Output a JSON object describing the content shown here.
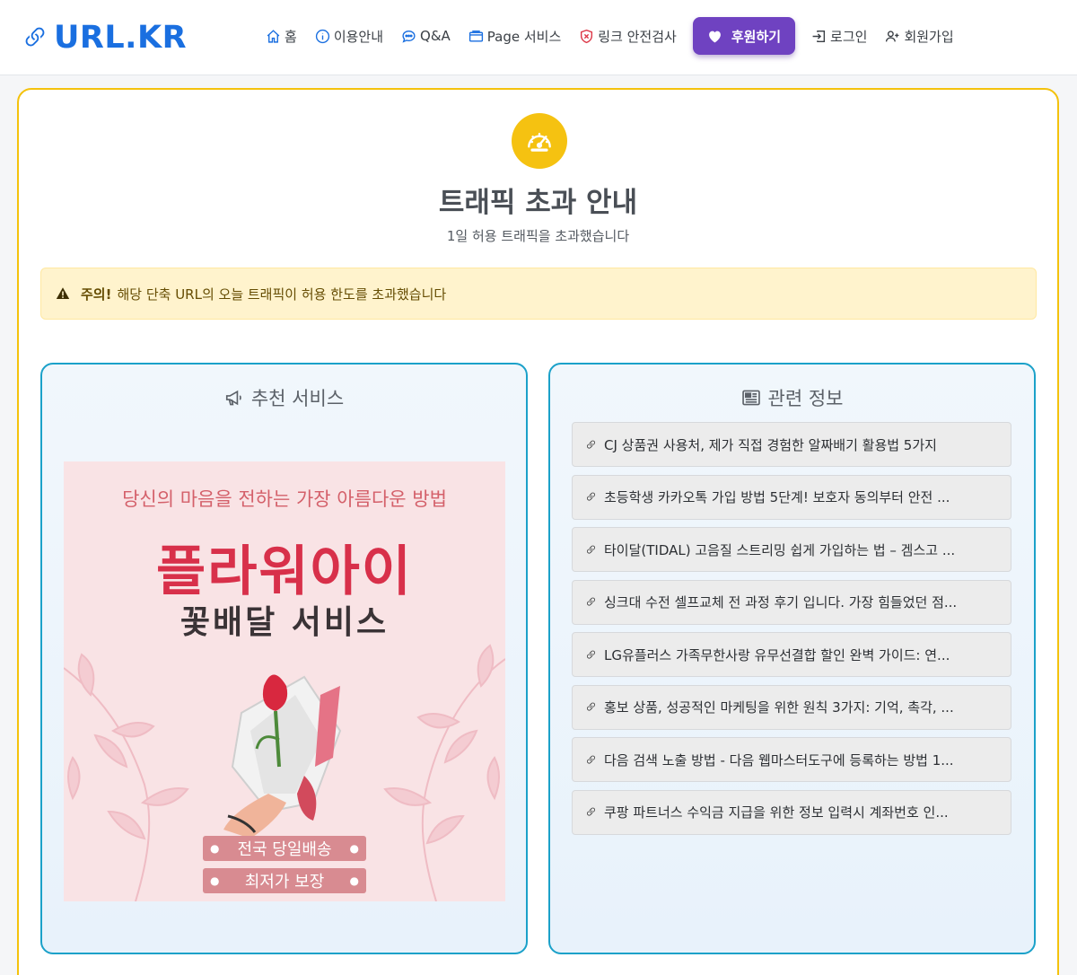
{
  "brand": {
    "name": "URL.KR",
    "icon": "link-icon"
  },
  "nav": {
    "items": [
      {
        "label": "홈",
        "icon": "house-icon"
      },
      {
        "label": "이용안내",
        "icon": "info-circle-icon"
      },
      {
        "label": "Q&A",
        "icon": "chat-dots-icon"
      },
      {
        "label": "Page 서비스",
        "icon": "window-icon"
      },
      {
        "label": "링크 안전검사",
        "icon": "shield-x-icon"
      },
      {
        "label": "후원하기",
        "icon": "heart-icon"
      },
      {
        "label": "로그인",
        "icon": "box-arrow-in-right-icon"
      },
      {
        "label": "회원가입",
        "icon": "person-plus-icon"
      }
    ]
  },
  "main": {
    "icon": "speedometer-icon",
    "title": "트래픽 초과 안내",
    "subtitle": "1일 허용 트래픽을 초과했습니다",
    "alert": {
      "strong": "주의!",
      "text": "해당 단축 URL의 오늘 트래픽이 허용 한도를 초과했습니다"
    }
  },
  "recommend": {
    "title": "추천 서비스",
    "ad": {
      "tagline": "당신의 마음을 전하는 가장 아름다운 방법",
      "brand": "플라워아이",
      "service": "꽃배달 서비스",
      "pill1": "전국 당일배송",
      "pill2": "최저가 보장"
    }
  },
  "related": {
    "title": "관련 정보",
    "items": [
      "CJ 상품권 사용처, 제가 직접 경험한 알짜배기 활용법 5가지",
      "초등학생 카카오톡 가입 방법 5단계! 보호자 동의부터 안전 ...",
      "타이달(TIDAL) 고음질 스트리밍 쉽게 가입하는 법 – 겜스고 ...",
      "싱크대 수전 셀프교체 전 과정 후기 입니다. 가장 힘들었던 점...",
      "LG유플러스 가족무한사랑 유무선결합 할인 완벽 가이드: 연...",
      "홍보 상품, 성공적인 마케팅을 위한 원칙 3가지: 기억, 촉각, ...",
      "다음 검색 노출 방법 - 다음 웹마스터도구에 등록하는 방법 1...",
      "쿠팡 파트너스 수익금 지급을 위한 정보 입력시 계좌번호 인..."
    ]
  }
}
